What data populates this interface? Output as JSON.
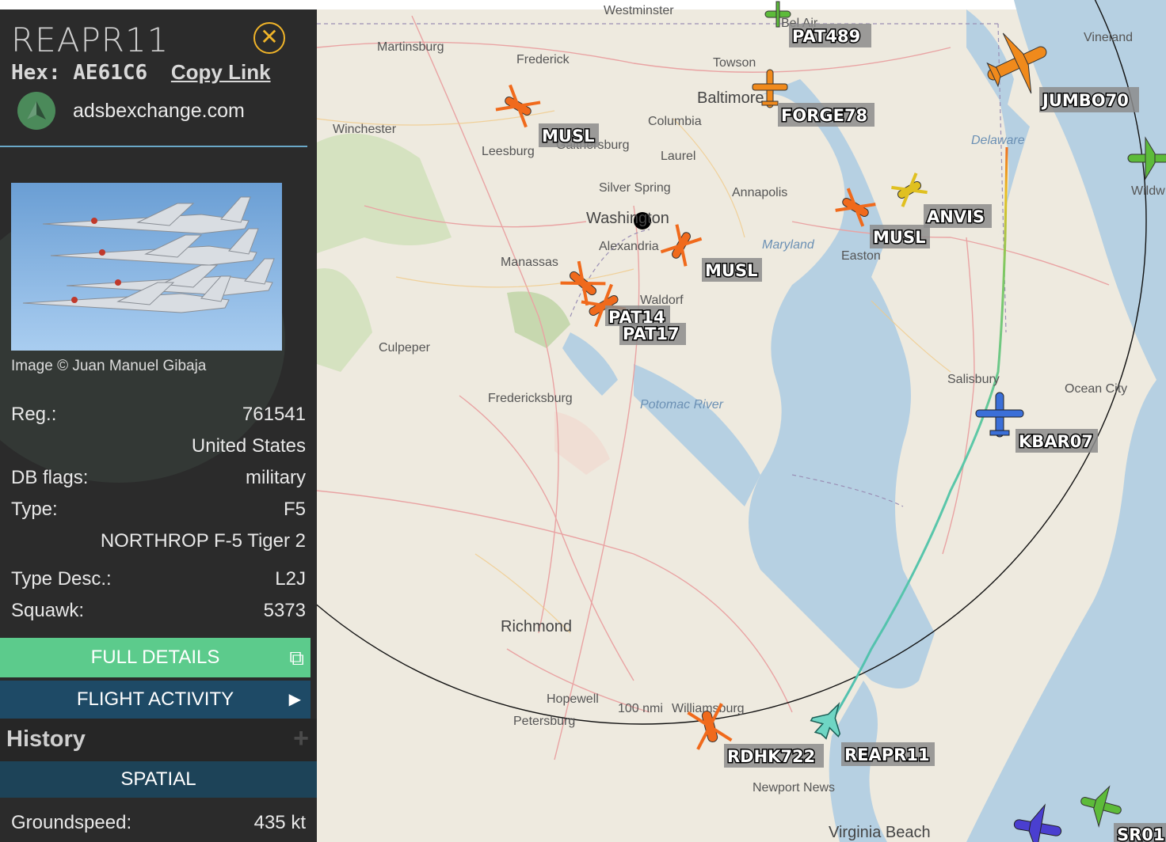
{
  "sidebar": {
    "callsign": "REAPR11",
    "hex_label": "Hex:",
    "hex_value": "AE61C6",
    "copy_link": "Copy Link",
    "source_site": "adsbexchange.com",
    "image_credit": "Image © Juan Manuel Gibaja",
    "reg_label": "Reg.:",
    "reg_value": "761541",
    "country": "United States",
    "db_flags_label": "DB flags:",
    "db_flags_value": "military",
    "type_label": "Type:",
    "type_value": "F5",
    "type_full": "NORTHROP F-5 Tiger 2",
    "type_desc_label": "Type Desc.:",
    "type_desc_value": "L2J",
    "squawk_label": "Squawk:",
    "squawk_value": "5373",
    "full_details": "FULL DETAILS",
    "flight_activity": "FLIGHT ACTIVITY",
    "history": "History",
    "spatial": "SPATIAL",
    "groundspeed_label": "Groundspeed:",
    "groundspeed_value": "435 kt",
    "colors": {
      "accent_green": "#5ccb8c",
      "accent_blue": "#1e4a66",
      "close_orange": "#f0b429"
    }
  },
  "map": {
    "range_ring_label": "100 nmi",
    "places": [
      "Westminster",
      "Martinsburg",
      "Frederick",
      "Bel Air",
      "Towson",
      "Baltimore",
      "Vineland",
      "Columbia",
      "Winchester",
      "Gaithersburg",
      "Leesburg",
      "Laurel",
      "Silver Spring",
      "Annapolis",
      "Washington",
      "Alexandria",
      "Manassas",
      "Waldorf",
      "Easton",
      "Culpeper",
      "Fredericksburg",
      "Salisbury",
      "Ocean City",
      "Richmond",
      "Hopewell",
      "Petersburg",
      "Williamsburg",
      "Newport News",
      "Virginia Beach",
      "Wildw"
    ],
    "water_labels": [
      "Delaware",
      "Maryland",
      "Potomac River"
    ],
    "aircraft": [
      {
        "callsign": "PAT489",
        "color": "#5dbb3a",
        "icon": "helicopter-icon"
      },
      {
        "callsign": "FORGE78",
        "color": "#f08a1c",
        "icon": "prop-plane-icon"
      },
      {
        "callsign": "JUMBO70",
        "color": "#f08a1c",
        "icon": "cargo-jet-icon"
      },
      {
        "callsign": "MUSL",
        "color": "#f06a1c",
        "icon": "helicopter-icon"
      },
      {
        "callsign": "ANVIS",
        "color": "#e0c020",
        "icon": "helicopter-icon"
      },
      {
        "callsign": "MUSL",
        "color": "#f06a1c",
        "icon": "helicopter-icon"
      },
      {
        "callsign": "MUSL",
        "color": "#f06a1c",
        "icon": "helicopter-icon"
      },
      {
        "callsign": "PAT14",
        "color": "#f06a1c",
        "icon": "helicopter-icon"
      },
      {
        "callsign": "PAT17",
        "color": "#f06a1c",
        "icon": "helicopter-icon"
      },
      {
        "callsign": "KBAR07",
        "color": "#3b6fd8",
        "icon": "prop-plane-icon"
      },
      {
        "callsign": "RDHK722",
        "color": "#f06a1c",
        "icon": "helicopter-icon"
      },
      {
        "callsign": "REAPR11",
        "color": "#6fd6c4",
        "icon": "fighter-jet-icon"
      },
      {
        "callsign": "SR01",
        "color": "#4a3fd0",
        "icon": "jet-icon"
      }
    ]
  }
}
